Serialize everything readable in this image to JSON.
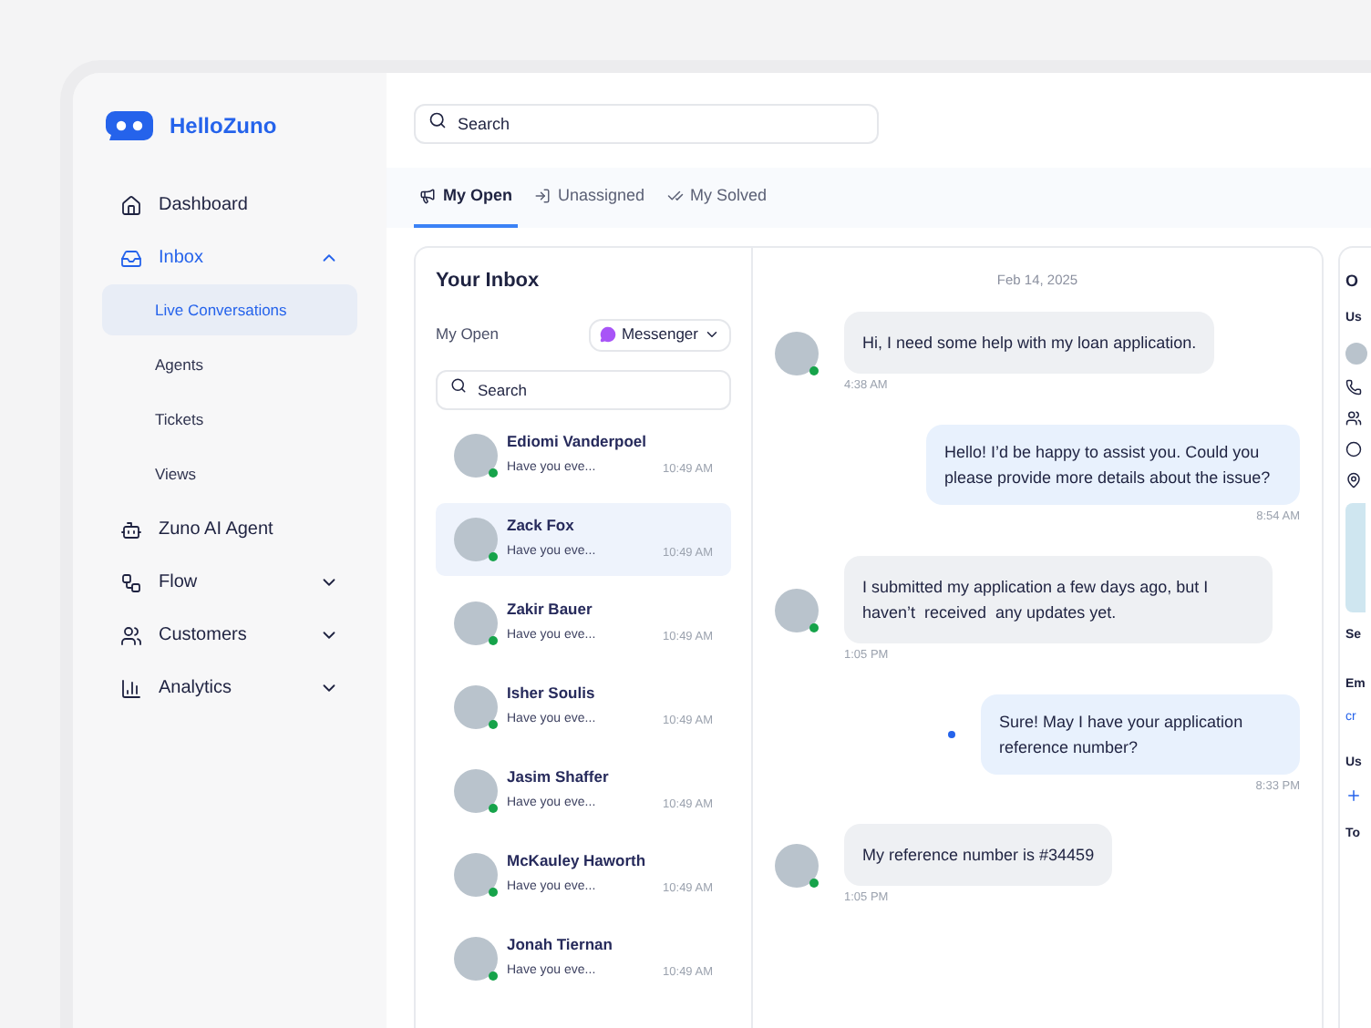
{
  "brand": "HelloZuno",
  "sidebar": {
    "items": [
      {
        "label": "Dashboard",
        "kind": "home",
        "selected": false
      },
      {
        "label": "Inbox",
        "kind": "inbox",
        "selected": true,
        "expanded": true,
        "children": [
          {
            "label": "Live Conversations",
            "selected": true
          },
          {
            "label": "Agents",
            "selected": false
          },
          {
            "label": "Tickets",
            "selected": false
          },
          {
            "label": "Views",
            "selected": false
          }
        ]
      },
      {
        "label": "Zuno AI Agent",
        "kind": "bot",
        "selected": false
      },
      {
        "label": "Flow",
        "kind": "flow",
        "selected": false,
        "expanded": false
      },
      {
        "label": "Customers",
        "kind": "people",
        "selected": false,
        "expanded": false
      },
      {
        "label": "Analytics",
        "kind": "chart",
        "selected": false,
        "expanded": false
      }
    ]
  },
  "search": {
    "placeholder": "Search"
  },
  "tabs": [
    {
      "label": "My Open",
      "kind": "open",
      "selected": true
    },
    {
      "label": "Unassigned",
      "kind": "unassigned",
      "selected": false
    },
    {
      "label": "My Solved",
      "kind": "solved",
      "selected": false
    }
  ],
  "inbox": {
    "title": "Your Inbox",
    "filter_label": "My Open",
    "channel": "Messenger",
    "search_placeholder": "Search",
    "conversations": [
      {
        "name": "Ediomi Vanderpoel",
        "preview": "Have you eve...",
        "time": "10:49 AM",
        "selected": false,
        "online": true
      },
      {
        "name": "Zack Fox",
        "preview": "Have you eve...",
        "time": "10:49 AM",
        "selected": true,
        "online": true
      },
      {
        "name": "Zakir Bauer",
        "preview": "Have you eve...",
        "time": "10:49 AM",
        "selected": false,
        "online": true
      },
      {
        "name": "Isher Soulis",
        "preview": "Have you eve...",
        "time": "10:49 AM",
        "selected": false,
        "online": true
      },
      {
        "name": "Jasim Shaffer",
        "preview": "Have you eve...",
        "time": "10:49 AM",
        "selected": false,
        "online": true
      },
      {
        "name": "McKauley Haworth",
        "preview": "Have you eve...",
        "time": "10:49 AM",
        "selected": false,
        "online": true
      },
      {
        "name": "Jonah Tiernan",
        "preview": "Have you eve...",
        "time": "10:49 AM",
        "selected": false,
        "online": true
      }
    ]
  },
  "chat": {
    "date": "Feb 14, 2025",
    "messages": [
      {
        "kind": "incoming",
        "text": "Hi, I need some help with my loan application.",
        "time": "4:38 AM",
        "dot": false
      },
      {
        "kind": "outgoing",
        "text": "Hello! I’d be happy to assist you. Could you please provide more details about the issue?",
        "time": "8:54 AM",
        "dot": false
      },
      {
        "kind": "incoming",
        "text": "I submitted my application a few days ago, but I haven’t  received  any updates yet.",
        "time": "1:05 PM",
        "dot": false
      },
      {
        "kind": "outgoing",
        "text": "Sure! May I have your application reference number?",
        "time": "8:33 PM",
        "dot": true
      },
      {
        "kind": "incoming",
        "text": "My reference number is #34459",
        "time": "1:05 PM",
        "dot": false
      }
    ]
  },
  "details_panel": {
    "title": "O",
    "heading_1": "Us",
    "heading_2": "Se",
    "heading_3": "Em",
    "link": "cr",
    "heading_4": "Us",
    "heading_5": "To"
  }
}
